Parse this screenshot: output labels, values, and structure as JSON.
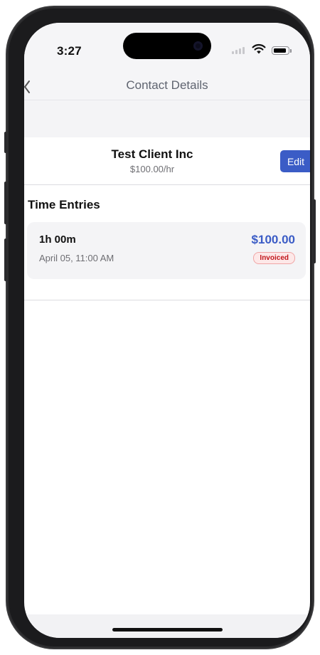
{
  "status_bar": {
    "time": "3:27",
    "signal_icon": "cellular-signal-icon",
    "wifi_icon": "wifi-icon",
    "battery_icon": "battery-icon",
    "battery_level": 0.9
  },
  "nav": {
    "back_icon": "chevron-left-icon",
    "title": "Contact Details"
  },
  "client": {
    "name": "Test Client Inc",
    "rate": "$100.00/hr",
    "edit_label": "Edit"
  },
  "time_entries": {
    "title": "Time Entries",
    "items": [
      {
        "duration": "1h 00m",
        "date": "April 05, 11:00 AM",
        "amount": "$100.00",
        "status": "Invoiced"
      }
    ]
  },
  "colors": {
    "accent": "#3b5cc6",
    "badge_text": "#c0151b",
    "badge_bg": "#fde8e8"
  }
}
